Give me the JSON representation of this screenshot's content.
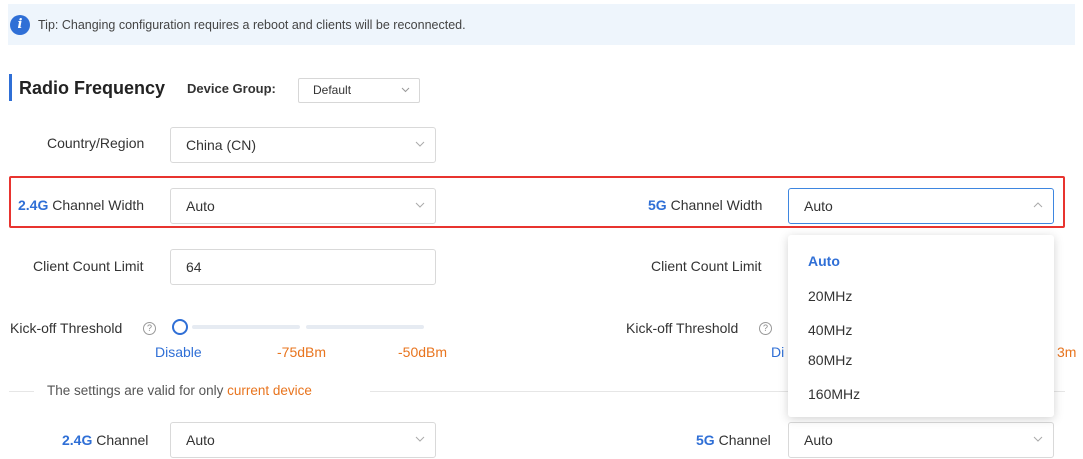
{
  "tip": {
    "text": "Tip: Changing configuration requires a reboot and clients will be reconnected."
  },
  "header": {
    "title": "Radio Frequency",
    "device_group_label": "Device Group:",
    "device_group_value": "Default"
  },
  "country": {
    "label": "Country/Region",
    "value": "China (CN)"
  },
  "channel_width_24": {
    "label_prefix": "2.4G",
    "label_suffix": " Channel Width",
    "value": "Auto"
  },
  "channel_width_5": {
    "label_prefix": "5G",
    "label_suffix": " Channel Width",
    "value": "Auto"
  },
  "client_limit_left": {
    "label": "Client Count Limit",
    "value": "64"
  },
  "client_limit_right": {
    "label": "Client Count Limit"
  },
  "kickoff_left": {
    "label": "Kick-off Threshold",
    "levels": [
      "Disable",
      "-75dBm",
      "-50dBm"
    ]
  },
  "kickoff_right": {
    "label": "Kick-off Threshold",
    "partial_left": "Di",
    "partial_right": "3m"
  },
  "divider": {
    "text_prefix": "The settings are valid for only ",
    "text_highlight": "current device"
  },
  "channel_24": {
    "label_prefix": "2.4G",
    "label_suffix": " Channel",
    "value": "Auto"
  },
  "channel_5": {
    "label_prefix": "5G",
    "label_suffix": " Channel",
    "value": "Auto"
  },
  "dropdown_options": [
    "Auto",
    "20MHz",
    "40MHz",
    "80MHz",
    "160MHz"
  ],
  "colors": {
    "accent": "#2f6fd6",
    "highlight_border": "#e8342f",
    "orange": "#e8741e",
    "slider_orange": "#e8741e"
  },
  "icons": {
    "tip": "info-icon",
    "help": "question-circle-icon",
    "chevron": "chevron-down-icon"
  }
}
